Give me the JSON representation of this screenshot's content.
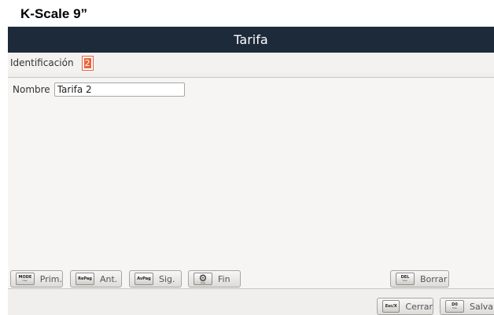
{
  "caption": "K-Scale 9”",
  "window": {
    "title": "Tarifa"
  },
  "id_field": {
    "label": "Identificación",
    "value": "2"
  },
  "name_field": {
    "label": "Nombre",
    "value": "Tarifa 2"
  },
  "buttons": {
    "first": {
      "key": "MODE",
      "key_sub": "tres.",
      "label": "Prim."
    },
    "prev": {
      "key": "RePag",
      "label": "Ant."
    },
    "next": {
      "key": "AvPag",
      "label": "Sig."
    },
    "last": {
      "icon": "gear-icon",
      "key_sub": "tres",
      "label": "Fin"
    },
    "delete": {
      "key": "DEL",
      "key_sub": "tres.",
      "label": "Borrar"
    },
    "close": {
      "key": "Esc/X",
      "label": "Cerrar"
    },
    "save": {
      "key": "D0",
      "key_sub": "tres",
      "label": "Salvar"
    }
  }
}
